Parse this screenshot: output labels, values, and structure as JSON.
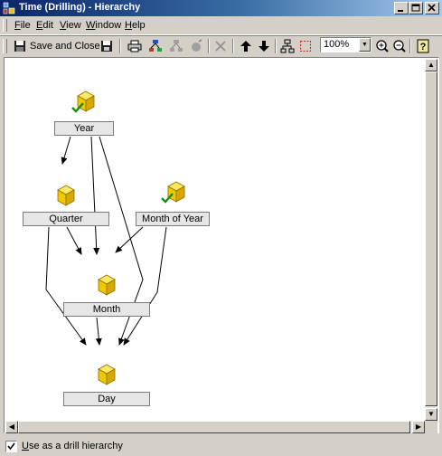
{
  "window": {
    "title": "Time (Drilling) - Hierarchy",
    "controls": [
      "minimize",
      "maximize",
      "close"
    ]
  },
  "menu": {
    "items": [
      {
        "label": "File",
        "accel": "F"
      },
      {
        "label": "Edit",
        "accel": "E"
      },
      {
        "label": "View",
        "accel": "V"
      },
      {
        "label": "Window",
        "accel": "W"
      },
      {
        "label": "Help",
        "accel": "H"
      }
    ]
  },
  "toolbar": {
    "save_close_label": "Save and Close",
    "icons": [
      "save-close-icon",
      "save-icon",
      "print-icon",
      "add-attribute-icon",
      "add-child-icon",
      "remove-icon",
      "delete-icon",
      "move-up-icon",
      "move-down-icon",
      "auto-arrange-icon",
      "select-area-icon",
      "zoom-in-icon",
      "zoom-out-icon",
      "help-icon"
    ],
    "zoom": {
      "value": "100%"
    }
  },
  "hierarchy": {
    "nodes": [
      {
        "id": "year",
        "label": "Year",
        "entry_point": true
      },
      {
        "id": "quarter",
        "label": "Quarter",
        "entry_point": false
      },
      {
        "id": "month_of_year",
        "label": "Month of Year",
        "entry_point": true
      },
      {
        "id": "month",
        "label": "Month",
        "entry_point": false
      },
      {
        "id": "day",
        "label": "Day",
        "entry_point": false
      }
    ],
    "edges": [
      [
        "year",
        "quarter"
      ],
      [
        "year",
        "month"
      ],
      [
        "year",
        "day"
      ],
      [
        "quarter",
        "month"
      ],
      [
        "quarter",
        "day"
      ],
      [
        "month_of_year",
        "month"
      ],
      [
        "month_of_year",
        "day"
      ],
      [
        "month",
        "day"
      ]
    ]
  },
  "status": {
    "checkbox_label": "Use as a drill hierarchy",
    "checkbox_accel": "U",
    "checked": true
  }
}
